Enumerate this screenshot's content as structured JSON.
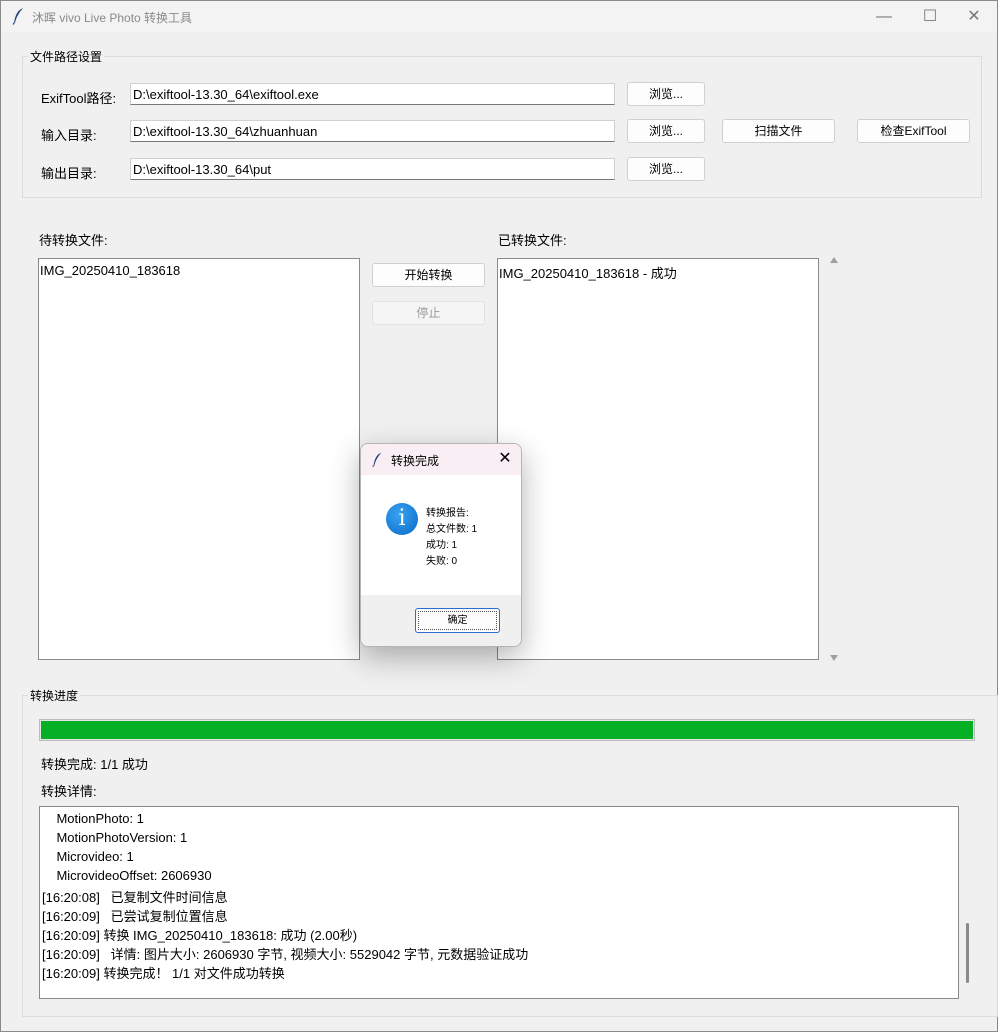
{
  "window": {
    "title": "沐晖 vivo Live Photo 转换工具",
    "controls": {
      "minimize": "—",
      "maximize": "☐",
      "close": "✕"
    }
  },
  "paths": {
    "group_title": "文件路径设置",
    "exiftool_label": "ExifTool路径:",
    "exiftool_value": "D:\\exiftool-13.30_64\\exiftool.exe",
    "input_label": "输入目录:",
    "input_value": "D:\\exiftool-13.30_64\\zhuanhuan",
    "output_label": "输出目录:",
    "output_value": "D:\\exiftool-13.30_64\\put",
    "browse_label": "浏览...",
    "scan_label": "扫描文件",
    "check_label": "检查ExifTool"
  },
  "pending": {
    "title": "待转换文件:",
    "items": [
      "IMG_20250410_183618"
    ]
  },
  "actions": {
    "start_label": "开始转换",
    "stop_label": "停止"
  },
  "converted": {
    "title": "已转换文件:",
    "items": [
      "IMG_20250410_183618 - 成功"
    ]
  },
  "progress": {
    "group_title": "转换进度",
    "fraction": 1.0,
    "status": "转换完成: 1/1 成功",
    "fill_color": "#06b025",
    "details_label": "转换详情:",
    "log": [
      "    MotionPhoto: 1",
      "    MotionPhotoVersion: 1",
      "    Microvideo: 1",
      "    MicrovideoOffset: 2606930",
      "[16:20:08]   已复制文件时间信息",
      "[16:20:09]   已尝试复制位置信息",
      "[16:20:09] 转换 IMG_20250410_183618: 成功 (2.00秒)",
      "[16:20:09]   详情: 图片大小: 2606930 字节, 视频大小: 5529042 字节, 元数据验证成功",
      "[16:20:09] 转换完成！ 1/1 对文件成功转换"
    ]
  },
  "dialog": {
    "title": "转换完成",
    "close": "✕",
    "icon": "info-icon",
    "icon_glyph": "i",
    "lines": [
      "转换报告:",
      "总文件数: 1",
      "成功: 1",
      "失败: 0"
    ],
    "ok_label": "确定"
  }
}
